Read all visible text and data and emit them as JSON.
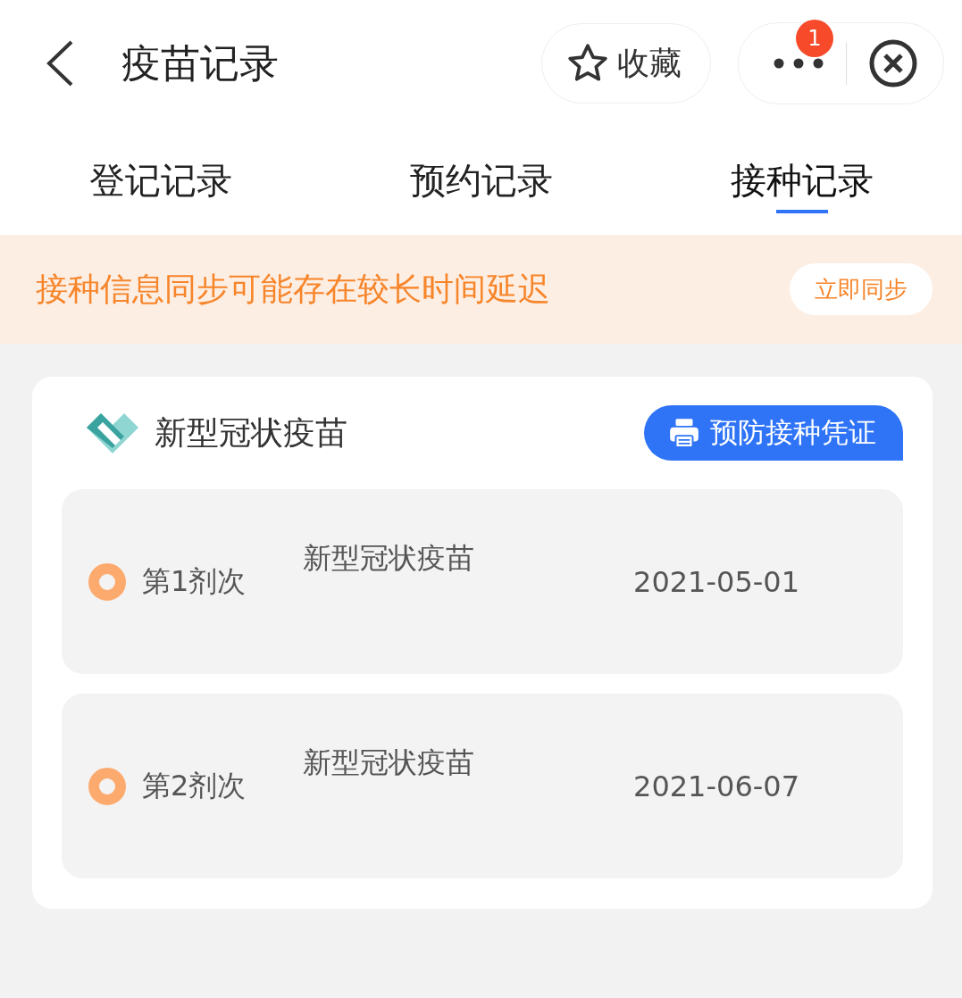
{
  "header": {
    "title": "疫苗记录",
    "favorite_button": "收藏",
    "badge": "1"
  },
  "tabs": [
    {
      "label": "登记记录",
      "selected": false
    },
    {
      "label": "预约记录",
      "selected": false
    },
    {
      "label": "接种记录",
      "selected": true
    }
  ],
  "notice": {
    "text": "接种信息同步可能存在较长时间延迟",
    "button": "立即同步"
  },
  "vaccine_card": {
    "title": "新型冠状疫苗",
    "certificate_button": "预防接种凭证",
    "doses": [
      {
        "dose": "第1剂次",
        "vaccine": "新型冠状疫苗",
        "date": "2021-05-01"
      },
      {
        "dose": "第2剂次",
        "vaccine": "新型冠状疫苗",
        "date": "2021-06-07"
      }
    ]
  }
}
